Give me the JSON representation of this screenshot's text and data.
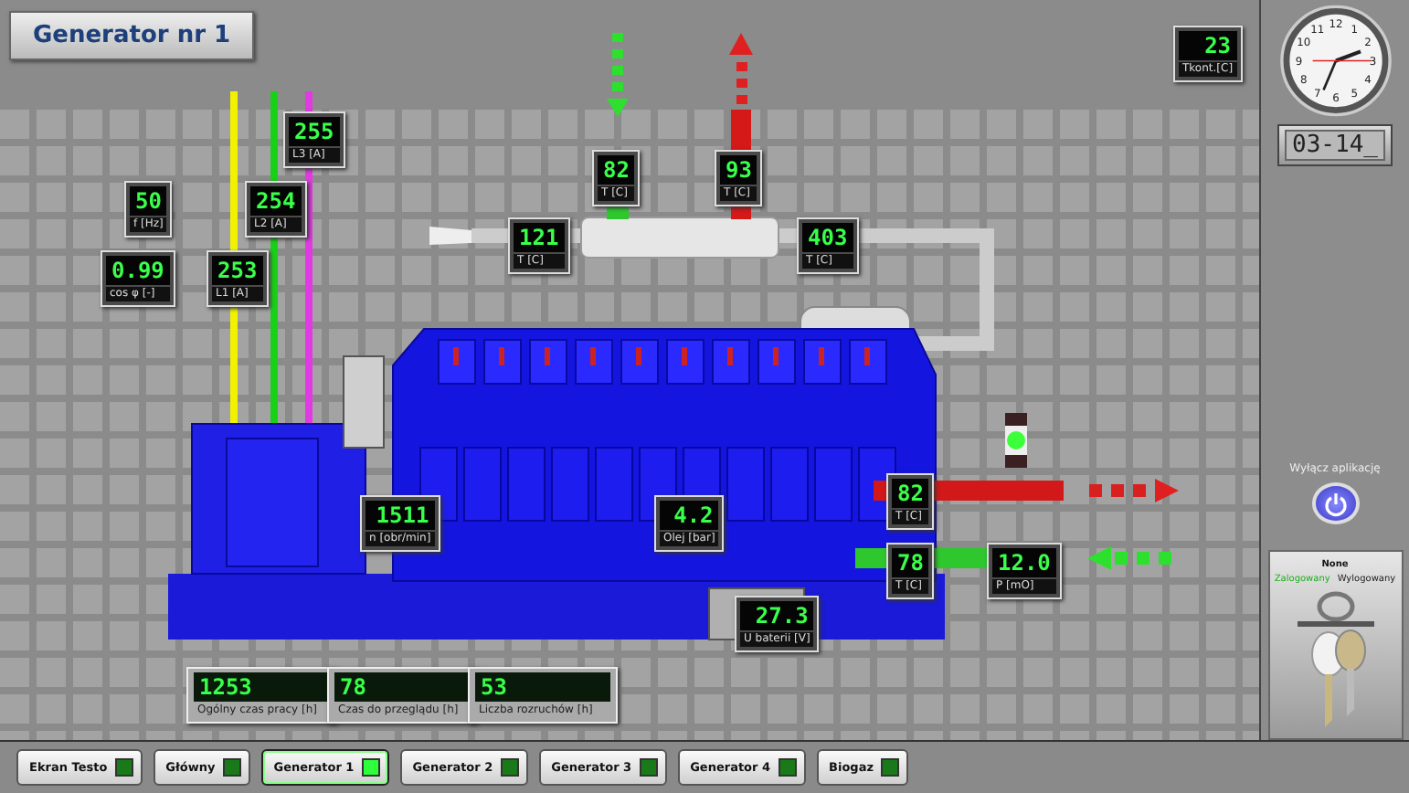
{
  "title": "Generator nr 1",
  "readouts": [
    {
      "value": "255",
      "label": "L3 [A]"
    },
    {
      "value": "50",
      "label": "f [Hz]"
    },
    {
      "value": "254",
      "label": "L2 [A]"
    },
    {
      "value": "0.99",
      "label": "cos φ [-]"
    },
    {
      "value": "253",
      "label": "L1 [A]"
    },
    {
      "value": "82",
      "label": "T [C]"
    },
    {
      "value": "93",
      "label": "T [C]"
    },
    {
      "value": "121",
      "label": "T [C]"
    },
    {
      "value": "403",
      "label": "T [C]"
    },
    {
      "value": "1511",
      "label": "n [obr/min]"
    },
    {
      "value": "4.2",
      "label": "Olej [bar]"
    },
    {
      "value": "82",
      "label": "T [C]"
    },
    {
      "value": "78",
      "label": "T [C]"
    },
    {
      "value": "12.0",
      "label": "P [mO]"
    },
    {
      "value": "27.3",
      "label": "U baterii [V]"
    },
    {
      "value": "23",
      "label": "Tkont.[C]"
    }
  ],
  "indicator": {
    "on": true
  },
  "counters": [
    {
      "value": "1253",
      "label": "Ogólny czas pracy [h]"
    },
    {
      "value": "78",
      "label": "Czas do przeglądu [h]"
    },
    {
      "value": "53",
      "label": "Liczba rozruchów [h]"
    }
  ],
  "clock": {
    "numerals": [
      "12",
      "11",
      "1",
      "10",
      "2",
      "9",
      "3",
      "8",
      "4",
      "7",
      "5",
      "6"
    ],
    "digital": "03-14_"
  },
  "exit": {
    "label": "Wyłącz aplikację"
  },
  "login": {
    "user": "None",
    "logged_in_label": "Zalogowany",
    "logged_out_label": "Wylogowany",
    "logged_in": true
  },
  "nav": [
    {
      "label": "Ekran Testo",
      "selected": false
    },
    {
      "label": "Główny",
      "selected": false
    },
    {
      "label": "Generator 1",
      "selected": true
    },
    {
      "label": "Generator 2",
      "selected": false
    },
    {
      "label": "Generator 3",
      "selected": false
    },
    {
      "label": "Generator 4",
      "selected": false
    },
    {
      "label": "Biogaz",
      "selected": false
    }
  ]
}
